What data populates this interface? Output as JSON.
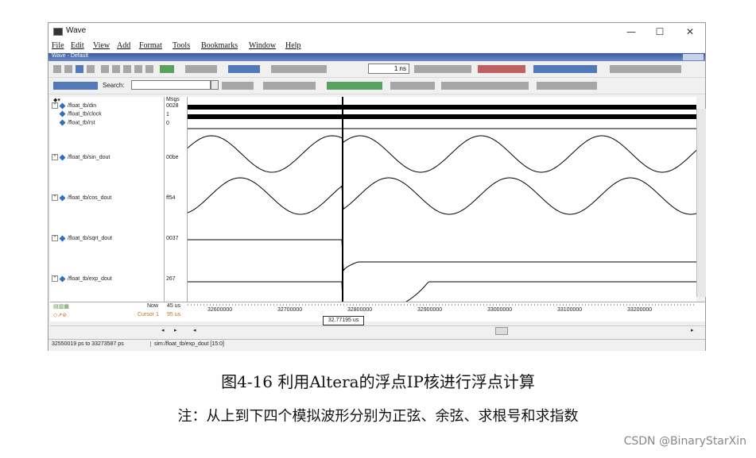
{
  "window": {
    "title": "Wave",
    "controls": {
      "minimize": "—",
      "maximize": "☐",
      "close": "✕"
    }
  },
  "menu": [
    "File",
    "Edit",
    "View",
    "Add",
    "Format",
    "Tools",
    "Bookmarks",
    "Window",
    "Help"
  ],
  "subwindow": {
    "title": "Wave - Default"
  },
  "toolbar": {
    "search_label": "Search:",
    "time_value": "1 ns"
  },
  "wave_header": {
    "msgs_label": "Msgs"
  },
  "signals": [
    {
      "name": "/float_tb/din",
      "value": "0028",
      "expandable": true,
      "type": "bus"
    },
    {
      "name": "/float_tb/clock",
      "value": "1",
      "expandable": false,
      "type": "clock"
    },
    {
      "name": "/float_tb/rst",
      "value": "0",
      "expandable": false,
      "type": "bit"
    },
    {
      "name": "/float_tb/sin_dout",
      "value": "00be",
      "expandable": true,
      "type": "analog-sin"
    },
    {
      "name": "/float_tb/cos_dout",
      "value": "ff54",
      "expandable": true,
      "type": "analog-cos"
    },
    {
      "name": "/float_tb/sqrt_dout",
      "value": "0037",
      "expandable": true,
      "type": "analog-sqrt"
    },
    {
      "name": "/float_tb/exp_dout",
      "value": "267",
      "expandable": true,
      "type": "analog-exp"
    }
  ],
  "timeline": {
    "now_label": "Now",
    "now_value": "45 us",
    "cursor_label": "Cursor 1",
    "cursor_value": "95 us",
    "ticks": [
      "32600000",
      "32700000",
      "32800000",
      "32900000",
      "33000000",
      "33100000",
      "33200000"
    ],
    "cursor_tag": "32.77195 us"
  },
  "status": {
    "range": "32550019 ps to 33273587 ps",
    "signal": "sim:/float_tb/exp_dout [15:0]"
  },
  "caption": "图4-16 利用Altera的浮点IP核进行浮点计算",
  "note": "注：从上到下四个模拟波形分别为正弦、余弦、求根号和求指数",
  "watermark": "CSDN @BinaryStarXin",
  "colors": {
    "trace": "#000000",
    "cursor": "#000000",
    "accent": "#2f6fc0"
  }
}
